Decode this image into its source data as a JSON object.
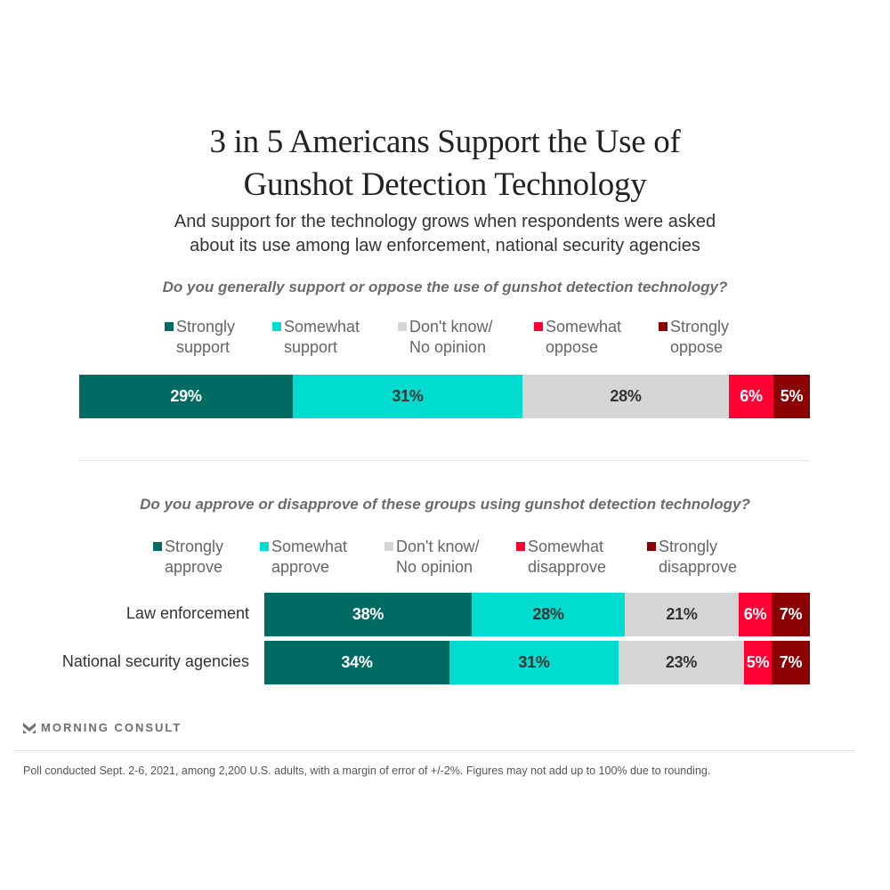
{
  "title": [
    "3 in 5 Americans Support the Use of",
    "Gunshot Detection Technology"
  ],
  "subtitle": [
    "And support for the technology grows when respondents were asked",
    "about its use among law enforcement, national security agencies"
  ],
  "chart_data": [
    {
      "type": "bar",
      "orientation": "horizontal-stacked",
      "question": "Do you generally support or oppose the use of gunshot detection technology?",
      "legend": [
        {
          "line1": "Strongly",
          "line2": "support",
          "color": "#006b63"
        },
        {
          "line1": "Somewhat",
          "line2": "support",
          "color": "#00dccf"
        },
        {
          "line1": "Don't know/",
          "line2": "No opinion",
          "color": "#d6d6d6"
        },
        {
          "line1": "Somewhat",
          "line2": "oppose",
          "color": "#ff0033"
        },
        {
          "line1": "Strongly",
          "line2": "oppose",
          "color": "#8b0000"
        }
      ],
      "legend_position": "top",
      "categories": [
        ""
      ],
      "series": [
        {
          "name": "Strongly support",
          "values": [
            29
          ],
          "label": [
            "29%"
          ],
          "label_color": "#ffffff"
        },
        {
          "name": "Somewhat support",
          "values": [
            31
          ],
          "label": [
            "31%"
          ],
          "label_color": "#333333"
        },
        {
          "name": "Don't know/No opinion",
          "values": [
            28
          ],
          "label": [
            "28%"
          ],
          "label_color": "#333333"
        },
        {
          "name": "Somewhat oppose",
          "values": [
            6
          ],
          "label": [
            "6%"
          ],
          "label_color": "#ffffff"
        },
        {
          "name": "Strongly oppose",
          "values": [
            5
          ],
          "label": [
            "5%"
          ],
          "label_color": "#ffffff"
        }
      ],
      "xlim": [
        0,
        100
      ]
    },
    {
      "type": "bar",
      "orientation": "horizontal-stacked",
      "question": "Do you approve or disapprove of these groups using gunshot detection technology?",
      "legend": [
        {
          "line1": "Strongly",
          "line2": "approve",
          "color": "#006b63"
        },
        {
          "line1": "Somewhat",
          "line2": "approve",
          "color": "#00dccf"
        },
        {
          "line1": "Don't know/",
          "line2": "No opinion",
          "color": "#d6d6d6"
        },
        {
          "line1": "Somewhat",
          "line2": "disapprove",
          "color": "#ff0033"
        },
        {
          "line1": "Strongly",
          "line2": "disapprove",
          "color": "#8b0000"
        }
      ],
      "legend_position": "top",
      "categories": [
        "Law enforcement",
        "National security agencies"
      ],
      "series": [
        {
          "name": "Strongly approve",
          "values": [
            38,
            34
          ],
          "label": [
            "38%",
            "34%"
          ],
          "label_color": "#ffffff"
        },
        {
          "name": "Somewhat approve",
          "values": [
            28,
            31
          ],
          "label": [
            "28%",
            "31%"
          ],
          "label_color": "#333333"
        },
        {
          "name": "Don't know/No opinion",
          "values": [
            21,
            23
          ],
          "label": [
            "21%",
            "23%"
          ],
          "label_color": "#333333"
        },
        {
          "name": "Somewhat disapprove",
          "values": [
            6,
            5
          ],
          "label": [
            "6%",
            "5%"
          ],
          "label_color": "#ffffff"
        },
        {
          "name": "Strongly disapprove",
          "values": [
            7,
            7
          ],
          "label": [
            "7%",
            "7%"
          ],
          "label_color": "#ffffff"
        }
      ],
      "xlim": [
        0,
        100
      ]
    }
  ],
  "logo": {
    "text": "MORNING CONSULT",
    "tm": "·",
    "icon": "morning-consult-chevron-icon"
  },
  "footnote": "Poll conducted Sept. 2-6, 2021, among 2,200 U.S. adults, with a margin of error of +/-2%. Figures may not add up to 100% due to rounding."
}
